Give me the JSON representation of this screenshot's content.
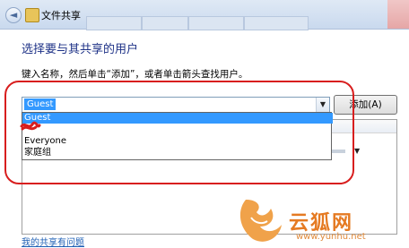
{
  "window": {
    "title": "文件共享",
    "back_glyph": "◄"
  },
  "heading": "选择要与其共享的用户",
  "instruction": "键入名称，然后单击“添加”，或者单击箭头查找用户。",
  "combo": {
    "value": "Guest",
    "arrow_glyph": "▼"
  },
  "add_button": "添加(A)",
  "dropdown": {
    "items": [
      "Guest",
      "",
      "Everyone",
      "家庭组"
    ],
    "selected_index": 0
  },
  "list": {
    "row_arrow_glyph": "▼"
  },
  "help_link": "我的共享有问题",
  "watermark": {
    "brand": "云狐网",
    "url": "www.yunhu.net"
  },
  "colors": {
    "heading": "#1e3287",
    "selection": "#3399ff",
    "annotation": "#d81e1e",
    "watermark": "#e57a22"
  }
}
